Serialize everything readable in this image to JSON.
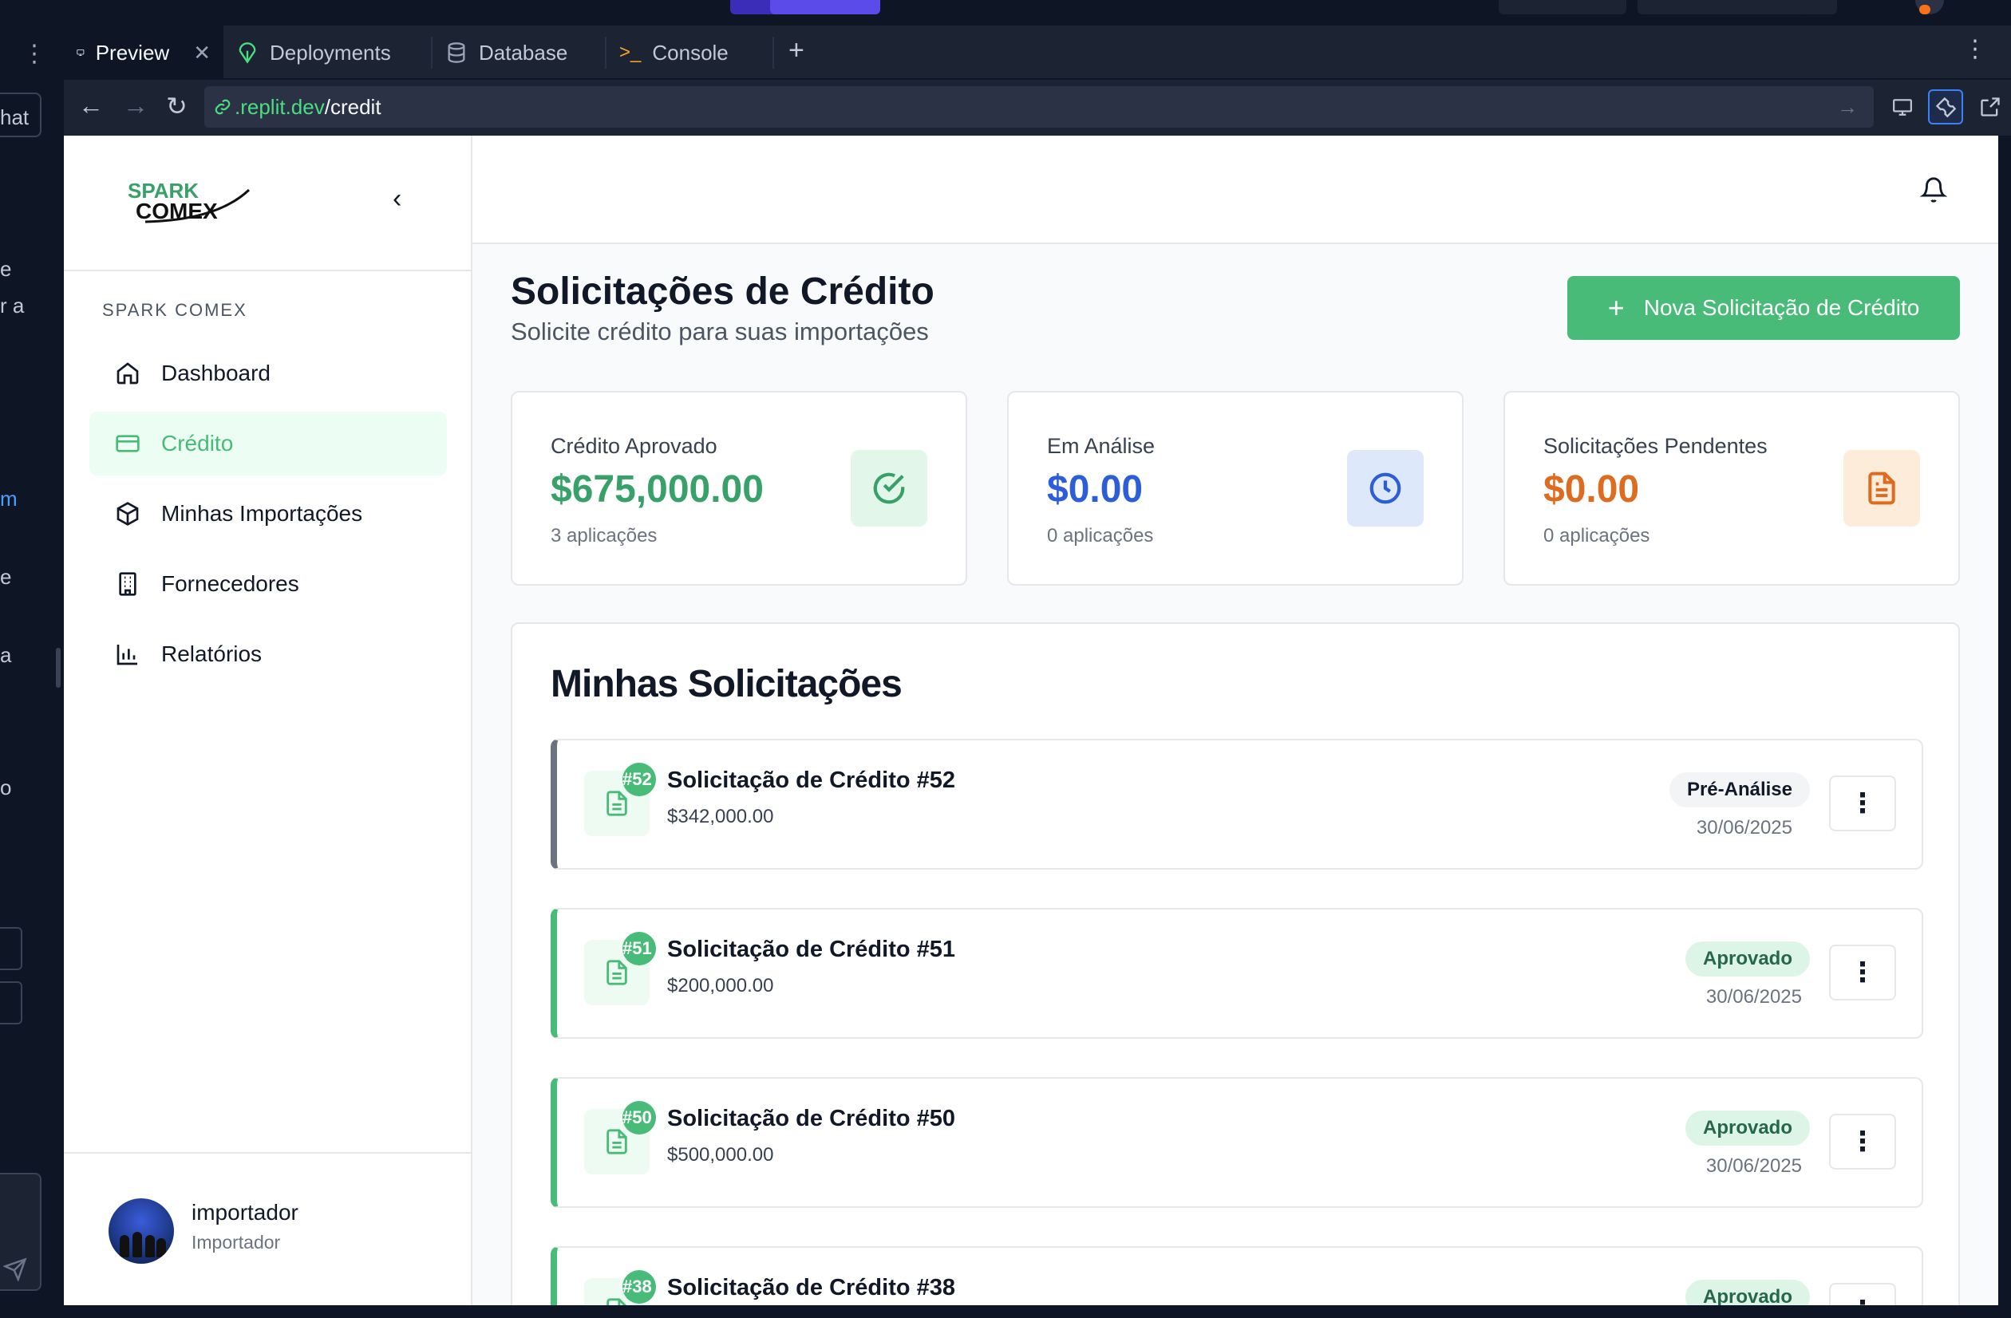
{
  "ide": {
    "tabs": [
      {
        "label": "Preview",
        "icon": "monitor-icon"
      },
      {
        "label": "Deployments",
        "icon": "deploy-icon"
      },
      {
        "label": "Database",
        "icon": "database-icon"
      },
      {
        "label": "Console",
        "icon": "terminal-icon"
      }
    ],
    "url": {
      "host": ".replit.dev",
      "path": "/credit"
    },
    "left_fragments": [
      "hat",
      "e",
      "r a",
      "m",
      "e",
      "a",
      "o"
    ]
  },
  "sidebar": {
    "brand_top": "SPARK",
    "brand_bottom": "COMEX",
    "section": "SPARK COMEX",
    "items": [
      {
        "label": "Dashboard",
        "icon": "home-icon"
      },
      {
        "label": "Crédito",
        "icon": "credit-card-icon",
        "active": true
      },
      {
        "label": "Minhas Importações",
        "icon": "package-icon"
      },
      {
        "label": "Fornecedores",
        "icon": "building-icon"
      },
      {
        "label": "Relatórios",
        "icon": "bar-chart-icon"
      }
    ],
    "user": {
      "name": "importador",
      "role": "Importador"
    }
  },
  "page": {
    "title": "Solicitações de Crédito",
    "subtitle": "Solicite crédito para suas importações",
    "new_button": "Nova Solicitação de Crédito"
  },
  "stats": [
    {
      "label": "Crédito Aprovado",
      "value": "$675,000.00",
      "count": "3 aplicações",
      "color": "#38a169",
      "icon": "check-circle-icon"
    },
    {
      "label": "Em Análise",
      "value": "$0.00",
      "count": "0 aplicações",
      "color": "#2b5ed8",
      "icon": "clock-icon"
    },
    {
      "label": "Solicitações Pendentes",
      "value": "$0.00",
      "count": "0 aplicações",
      "color": "#dd6b20",
      "icon": "file-text-icon"
    }
  ],
  "requests_title": "Minhas Solicitações",
  "requests": [
    {
      "number": "#52",
      "title": "Solicitação de Crédito #52",
      "amount": "$342,000.00",
      "status": "Pré-Análise",
      "date": "30/06/2025"
    },
    {
      "number": "#51",
      "title": "Solicitação de Crédito #51",
      "amount": "$200,000.00",
      "status": "Aprovado",
      "date": "30/06/2025"
    },
    {
      "number": "#50",
      "title": "Solicitação de Crédito #50",
      "amount": "$500,000.00",
      "status": "Aprovado",
      "date": "30/06/2025"
    },
    {
      "number": "#38",
      "title": "Solicitação de Crédito #38",
      "amount": "",
      "status": "Aprovado",
      "date": ""
    }
  ],
  "colors": {
    "accent": "#48bb78",
    "ide_bg": "#0e1525",
    "ide_panel": "#1c2333"
  }
}
